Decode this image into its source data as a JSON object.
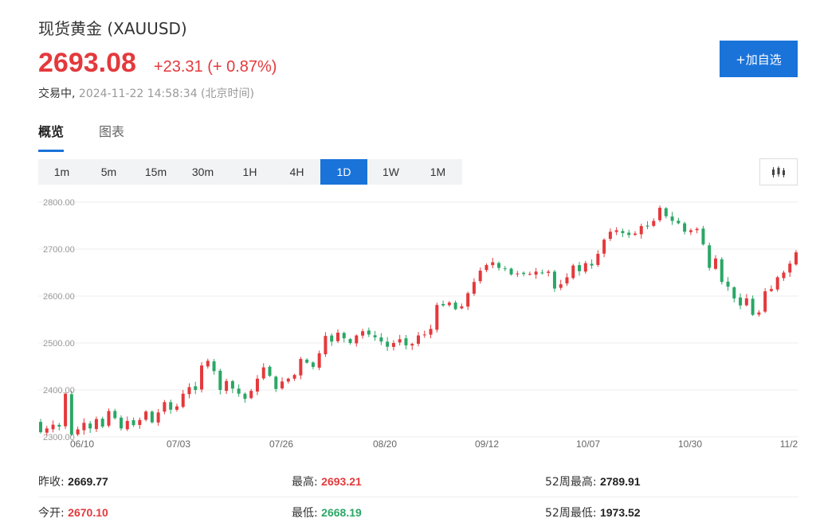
{
  "header": {
    "title": "现货黄金  (XAUUSD)",
    "price": "2693.08",
    "change": "+23.31 (+ 0.87%)",
    "status_label": "交易中,",
    "timestamp": "2024-11-22 14:58:34 (北京时间)"
  },
  "add_button_label": "+加自选",
  "tabs": [
    {
      "label": "概览",
      "active": true
    },
    {
      "label": "图表",
      "active": false
    }
  ],
  "intervals": [
    {
      "label": "1m",
      "active": false
    },
    {
      "label": "5m",
      "active": false
    },
    {
      "label": "15m",
      "active": false
    },
    {
      "label": "30m",
      "active": false
    },
    {
      "label": "1H",
      "active": false
    },
    {
      "label": "4H",
      "active": false
    },
    {
      "label": "1D",
      "active": true
    },
    {
      "label": "1W",
      "active": false
    },
    {
      "label": "1M",
      "active": false
    }
  ],
  "colors": {
    "up": "#e4393c",
    "down": "#2aa766",
    "accent": "#1a73d9"
  },
  "chart_data": {
    "type": "candlestick",
    "y_ticks": [
      "2800.00",
      "2700.00",
      "2600.00",
      "2500.00",
      "2400.00",
      "2300.00"
    ],
    "ylim": [
      2300,
      2800
    ],
    "x_ticks": [
      "06/10",
      "07/03",
      "07/26",
      "08/20",
      "09/12",
      "10/07",
      "10/30",
      "11/2"
    ],
    "closes": [
      2310,
      2318,
      2326,
      2322,
      2392,
      2305,
      2316,
      2330,
      2318,
      2338,
      2322,
      2355,
      2340,
      2318,
      2334,
      2325,
      2336,
      2354,
      2331,
      2352,
      2374,
      2358,
      2365,
      2392,
      2406,
      2400,
      2452,
      2462,
      2440,
      2400,
      2419,
      2403,
      2392,
      2381,
      2398,
      2424,
      2448,
      2430,
      2402,
      2418,
      2424,
      2432,
      2466,
      2458,
      2449,
      2478,
      2515,
      2503,
      2522,
      2510,
      2500,
      2516,
      2525,
      2518,
      2512,
      2503,
      2492,
      2500,
      2508,
      2495,
      2498,
      2516,
      2518,
      2530,
      2581,
      2580,
      2586,
      2572,
      2578,
      2606,
      2630,
      2654,
      2666,
      2672,
      2660,
      2659,
      2646,
      2648,
      2647,
      2647,
      2652,
      2650,
      2652,
      2616,
      2625,
      2640,
      2665,
      2653,
      2670,
      2665,
      2690,
      2720,
      2737,
      2740,
      2734,
      2730,
      2733,
      2749,
      2748,
      2760,
      2788,
      2770,
      2760,
      2755,
      2737,
      2740,
      2743,
      2710,
      2660,
      2680,
      2630,
      2620,
      2595,
      2580,
      2595,
      2560,
      2565,
      2610,
      2615,
      2640,
      2650,
      2669,
      2693
    ],
    "open_first": 2332,
    "range_note": "daily OHLC from Jun 2024 to Nov 22 2024"
  },
  "stats": [
    [
      {
        "label": "昨收:",
        "value": "2669.77",
        "color": "dark"
      },
      {
        "label": "最高:",
        "value": "2693.21",
        "color": "red"
      },
      {
        "label": "52周最高:",
        "value": "2789.91",
        "color": "dark"
      }
    ],
    [
      {
        "label": "今开:",
        "value": "2670.10",
        "color": "red"
      },
      {
        "label": "最低:",
        "value": "2668.19",
        "color": "green"
      },
      {
        "label": "52周最低:",
        "value": "1973.52",
        "color": "dark"
      }
    ]
  ]
}
